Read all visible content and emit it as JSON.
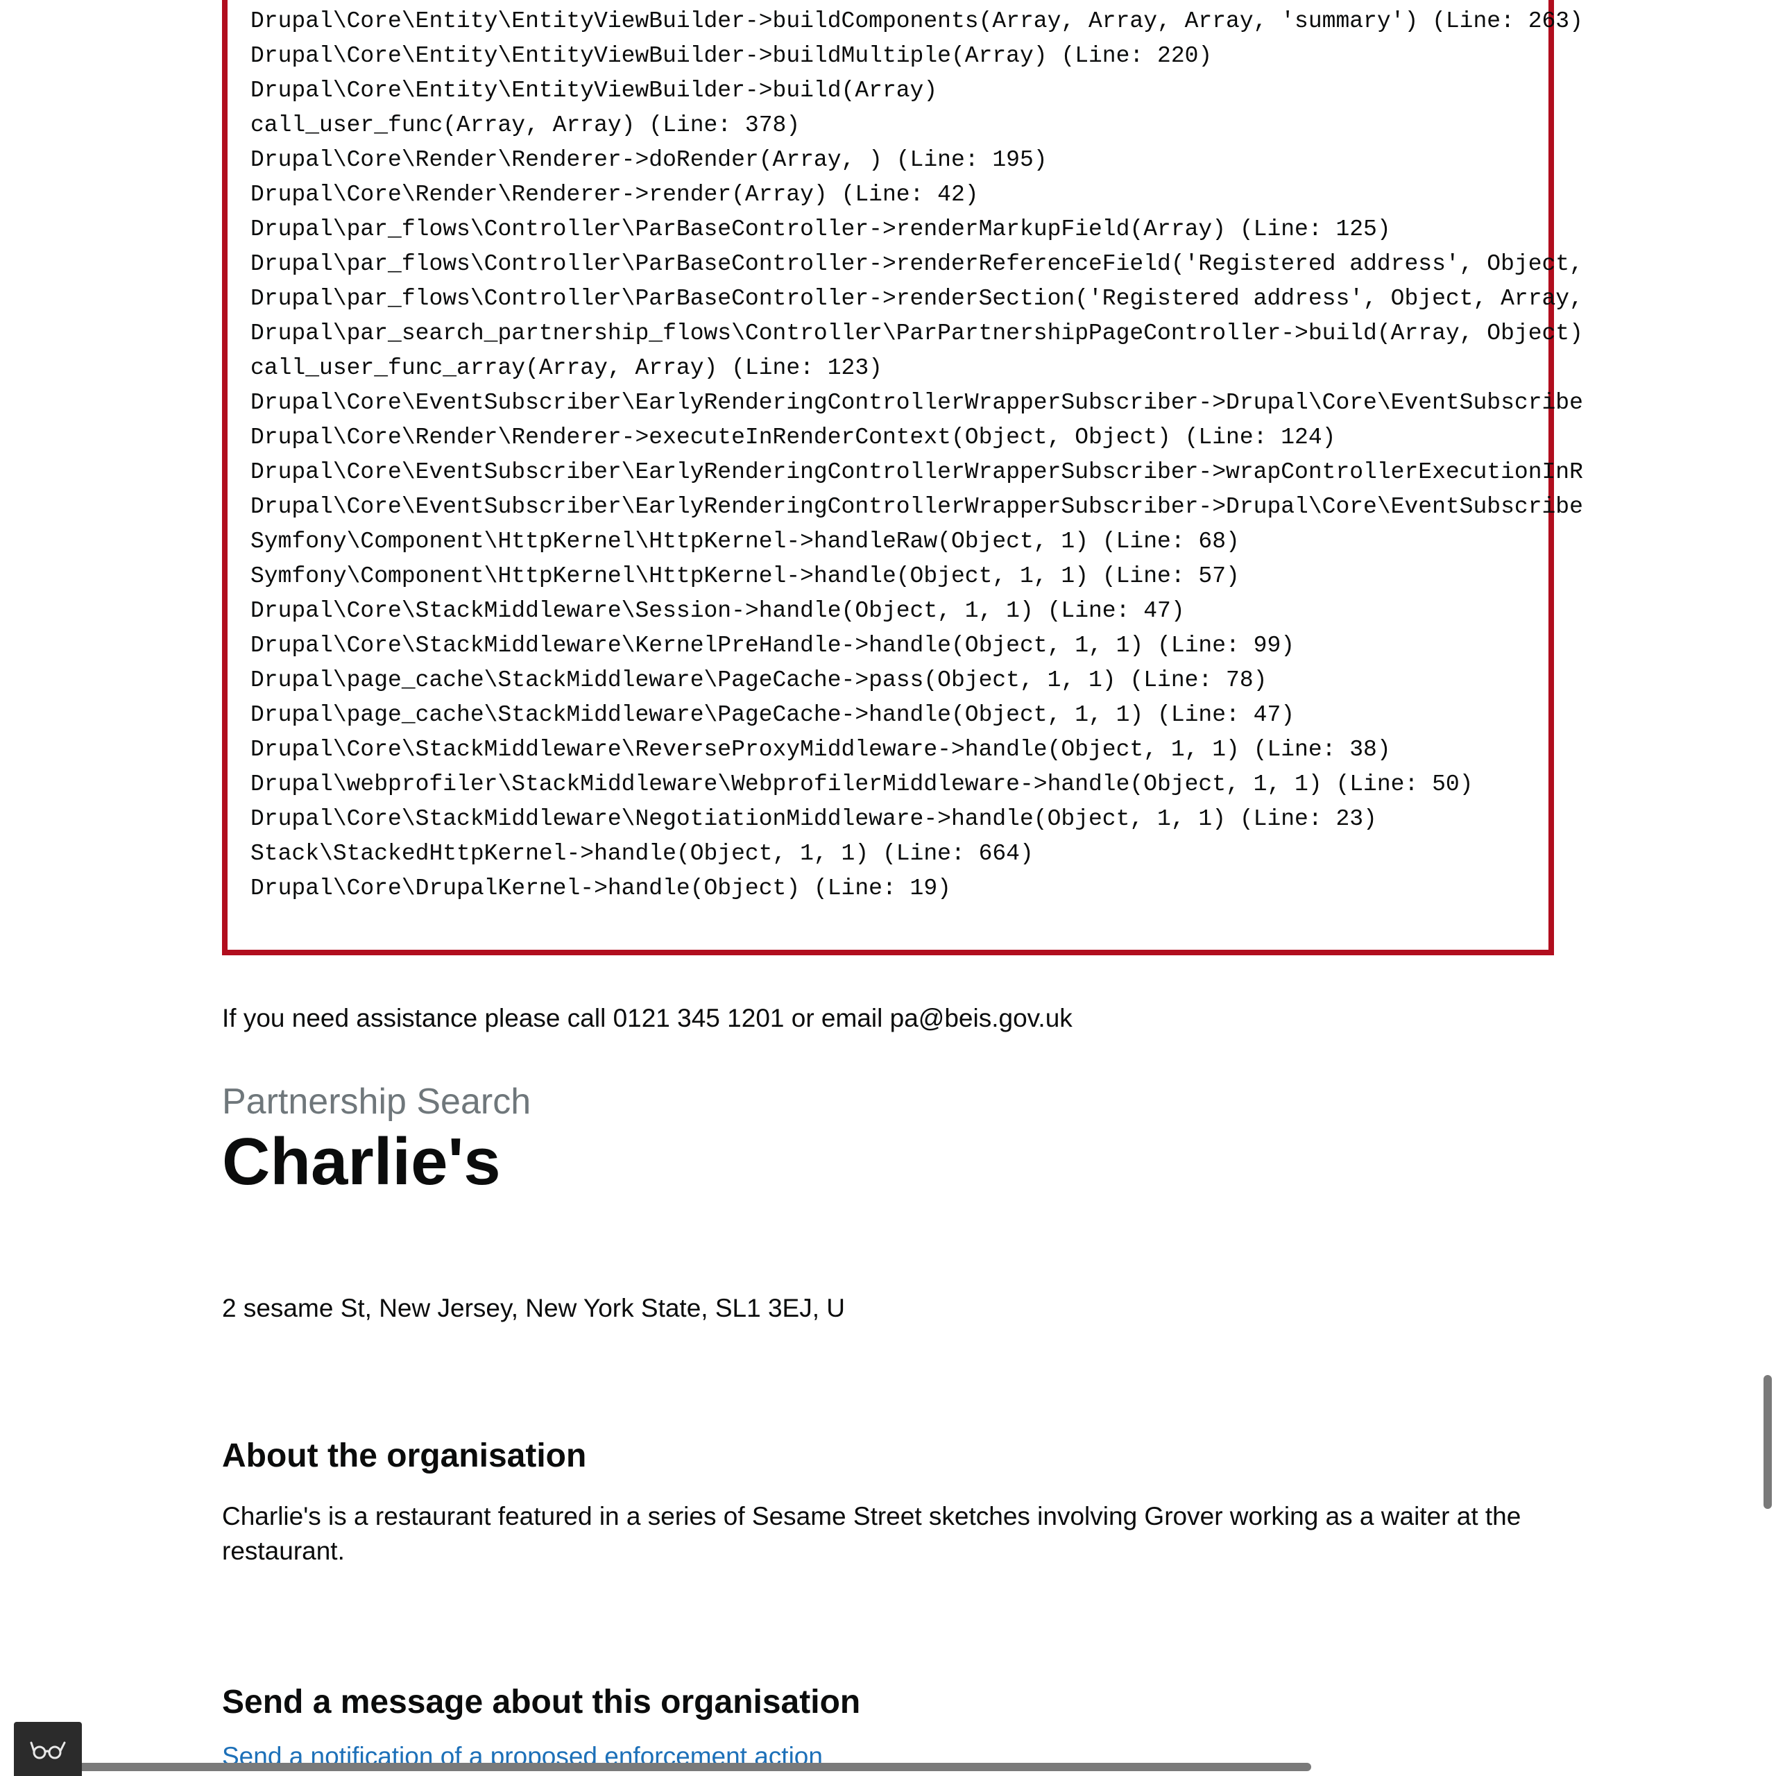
{
  "error": {
    "trace": [
      "Drupal\\Core\\Entity\\EntityViewBuilder->buildComponents(Array, Array, Array, 'summary') (Line: 263)",
      "Drupal\\Core\\Entity\\EntityViewBuilder->buildMultiple(Array) (Line: 220)",
      "Drupal\\Core\\Entity\\EntityViewBuilder->build(Array)",
      "call_user_func(Array, Array) (Line: 378)",
      "Drupal\\Core\\Render\\Renderer->doRender(Array, ) (Line: 195)",
      "Drupal\\Core\\Render\\Renderer->render(Array) (Line: 42)",
      "Drupal\\par_flows\\Controller\\ParBaseController->renderMarkupField(Array) (Line: 125)",
      "Drupal\\par_flows\\Controller\\ParBaseController->renderReferenceField('Registered address', Object,",
      "Drupal\\par_flows\\Controller\\ParBaseController->renderSection('Registered address', Object, Array,",
      "Drupal\\par_search_partnership_flows\\Controller\\ParPartnershipPageController->build(Array, Object)",
      "call_user_func_array(Array, Array) (Line: 123)",
      "Drupal\\Core\\EventSubscriber\\EarlyRenderingControllerWrapperSubscriber->Drupal\\Core\\EventSubscribe",
      "Drupal\\Core\\Render\\Renderer->executeInRenderContext(Object, Object) (Line: 124)",
      "Drupal\\Core\\EventSubscriber\\EarlyRenderingControllerWrapperSubscriber->wrapControllerExecutionInR",
      "Drupal\\Core\\EventSubscriber\\EarlyRenderingControllerWrapperSubscriber->Drupal\\Core\\EventSubscribe",
      "Symfony\\Component\\HttpKernel\\HttpKernel->handleRaw(Object, 1) (Line: 68)",
      "Symfony\\Component\\HttpKernel\\HttpKernel->handle(Object, 1, 1) (Line: 57)",
      "Drupal\\Core\\StackMiddleware\\Session->handle(Object, 1, 1) (Line: 47)",
      "Drupal\\Core\\StackMiddleware\\KernelPreHandle->handle(Object, 1, 1) (Line: 99)",
      "Drupal\\page_cache\\StackMiddleware\\PageCache->pass(Object, 1, 1) (Line: 78)",
      "Drupal\\page_cache\\StackMiddleware\\PageCache->handle(Object, 1, 1) (Line: 47)",
      "Drupal\\Core\\StackMiddleware\\ReverseProxyMiddleware->handle(Object, 1, 1) (Line: 38)",
      "Drupal\\webprofiler\\StackMiddleware\\WebprofilerMiddleware->handle(Object, 1, 1) (Line: 50)",
      "Drupal\\Core\\StackMiddleware\\NegotiationMiddleware->handle(Object, 1, 1) (Line: 23)",
      "Stack\\StackedHttpKernel->handle(Object, 1, 1) (Line: 664)",
      "Drupal\\Core\\DrupalKernel->handle(Object) (Line: 19)"
    ],
    "border_color": "#b10e1e"
  },
  "assistance_text": "If you need assistance please call 0121 345 1201 or email pa@beis.gov.uk",
  "page": {
    "caption": "Partnership Search",
    "title": "Charlie's",
    "address": "2 sesame St, New Jersey, New York State, SL1 3EJ, U"
  },
  "about": {
    "heading": "About the organisation",
    "text": "Charlie's is a restaurant featured in a series of Sesame Street sketches involving Grover working as a waiter at the restaurant."
  },
  "message": {
    "heading": "Send a message about this organisation",
    "link_label": "Send a notification of a proposed enforcement action"
  },
  "profiler": {
    "icon": "glasses-icon"
  },
  "colors": {
    "text": "#0b0c0c",
    "caption": "#6f777b",
    "link": "#1d70b8",
    "error_border": "#b10e1e",
    "toolbar": "#2b2b2b"
  }
}
